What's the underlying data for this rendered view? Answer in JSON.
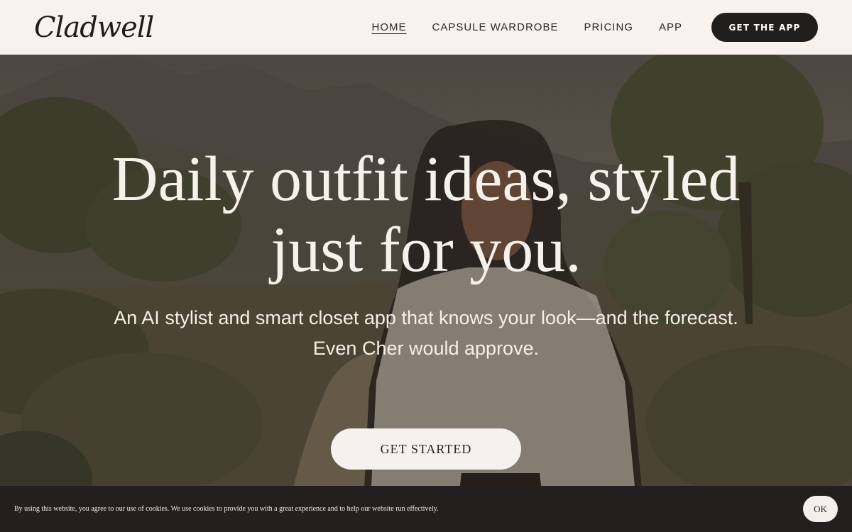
{
  "header": {
    "logo": "Cladwell",
    "nav": [
      {
        "label": "HOME"
      },
      {
        "label": "CAPSULE WARDROBE"
      },
      {
        "label": "PRICING"
      },
      {
        "label": "APP"
      }
    ],
    "cta_label": "GET THE APP"
  },
  "hero": {
    "headline_line1": "Daily outfit ideas, styled",
    "headline_line2": "just for you.",
    "sub_line1": "An AI stylist and smart closet app that knows your look—and the forecast.",
    "sub_line2": "Even Cher would approve.",
    "cta_label": "GET STARTED"
  },
  "cookie": {
    "text": "By using this website, you agree to our use of cookies. We use cookies to provide you with a great experience and to help our website run effectively.",
    "ok_label": "OK"
  },
  "colors": {
    "header_bg": "#f7f2ee",
    "dark_button": "#211f1e",
    "light_button": "#f6f1ec",
    "cookie_bg": "#221f1e"
  }
}
